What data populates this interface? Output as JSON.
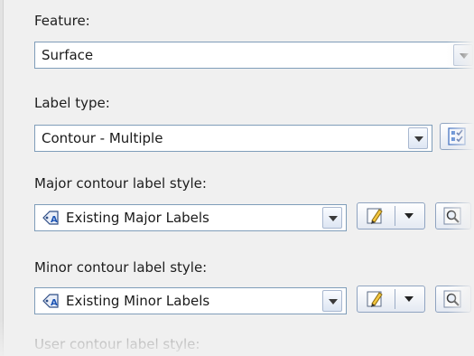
{
  "feature": {
    "label": "Feature:",
    "value": "Surface"
  },
  "label_type": {
    "label": "Label type:",
    "value": "Contour - Multiple"
  },
  "major_style": {
    "label": "Major contour label style:",
    "value": "Existing Major Labels"
  },
  "minor_style": {
    "label": "Minor contour label style:",
    "value": "Existing Minor Labels"
  },
  "user_style": {
    "label": "User contour label style:"
  },
  "icons": {
    "label_type_action": "checklist-icon",
    "style_item": "label-style-icon",
    "edit": "pencil-edit-icon",
    "preview": "magnifier-icon"
  },
  "colors": {
    "field_border": "#7f9db9",
    "button_border": "#8fa3c0",
    "accent": "#2a5caa"
  }
}
